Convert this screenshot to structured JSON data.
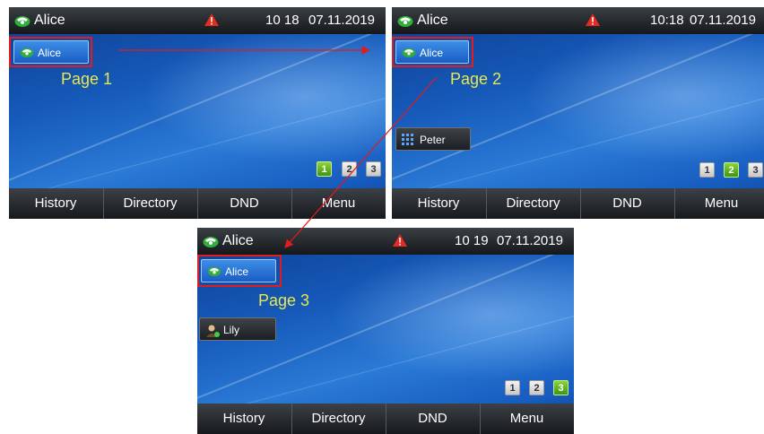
{
  "screens": [
    {
      "account": "Alice",
      "time": "10 18",
      "date": "07.11.2019",
      "line_keys": [
        {
          "label": "Alice",
          "icon": "phone-icon"
        }
      ],
      "page_label": "Page 1",
      "pages": [
        "1",
        "2",
        "3"
      ],
      "active_page": 1,
      "softkeys": [
        "History",
        "Directory",
        "DND",
        "Menu"
      ]
    },
    {
      "account": "Alice",
      "time": "10:18",
      "date": "07.11.2019",
      "line_keys": [
        {
          "label": "Alice",
          "icon": "phone-icon"
        },
        {
          "label": "Peter",
          "icon": "keypad-icon"
        }
      ],
      "page_label": "Page 2",
      "pages": [
        "1",
        "2",
        "3"
      ],
      "active_page": 2,
      "softkeys": [
        "History",
        "Directory",
        "DND",
        "Menu"
      ]
    },
    {
      "account": "Alice",
      "time": "10 19",
      "date": "07.11.2019",
      "line_keys": [
        {
          "label": "Alice",
          "icon": "phone-icon"
        },
        {
          "label": "Lily",
          "icon": "contact-icon"
        }
      ],
      "page_label": "Page 3",
      "pages": [
        "1",
        "2",
        "3"
      ],
      "active_page": 3,
      "softkeys": [
        "History",
        "Directory",
        "DND",
        "Menu"
      ]
    }
  ],
  "colors": {
    "highlight": "#e11c1c",
    "page_label": "#e8e84e",
    "active_page": "#5cb81f",
    "line_key_active": "#2a74d8"
  }
}
